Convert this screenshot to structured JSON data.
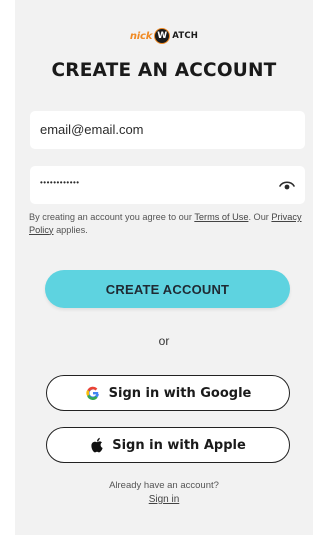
{
  "logo": {
    "prefix": "nick",
    "badge": "W",
    "suffix": "ATCH"
  },
  "title": "CREATE AN ACCOUNT",
  "form": {
    "email_value": "email@email.com",
    "password_value": "••••••••••••"
  },
  "terms": {
    "text_before": "By creating an account you agree to our ",
    "terms_link": "Terms of Use",
    "text_middle": ". Our ",
    "privacy_link": "Privacy Policy",
    "text_after": " applies."
  },
  "create_button": "CREATE ACCOUNT",
  "or": "or",
  "google_button": "Sign in with Google",
  "apple_button": "Sign in with Apple",
  "footer": {
    "prompt": "Already have an account?",
    "signin_link": "Sign in"
  },
  "colors": {
    "accent": "#5ed3e0",
    "background": "#f2f2f2",
    "logo_orange": "#f08a24"
  },
  "icons": [
    "eye-icon",
    "google-icon",
    "apple-icon"
  ]
}
